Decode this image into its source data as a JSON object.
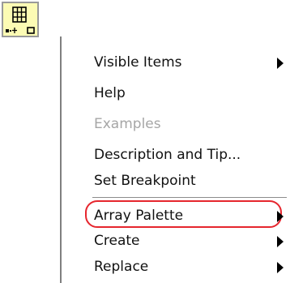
{
  "menu": {
    "items": [
      {
        "label": "Visible Items",
        "submenu": true
      },
      {
        "label": "Help"
      },
      {
        "label": "Examples",
        "disabled": true
      },
      {
        "label": "Description and Tip..."
      },
      {
        "label": "Set Breakpoint"
      },
      {
        "label": "Array Palette",
        "submenu": true,
        "highlighted": true
      },
      {
        "label": "Create",
        "submenu": true
      },
      {
        "label": "Replace",
        "submenu": true
      }
    ]
  },
  "icon": {
    "name": "array-node-icon"
  },
  "colors": {
    "highlight": "#e6262e",
    "icon_bg": "#fcfbb4",
    "disabled_text": "#a6a6a6"
  }
}
